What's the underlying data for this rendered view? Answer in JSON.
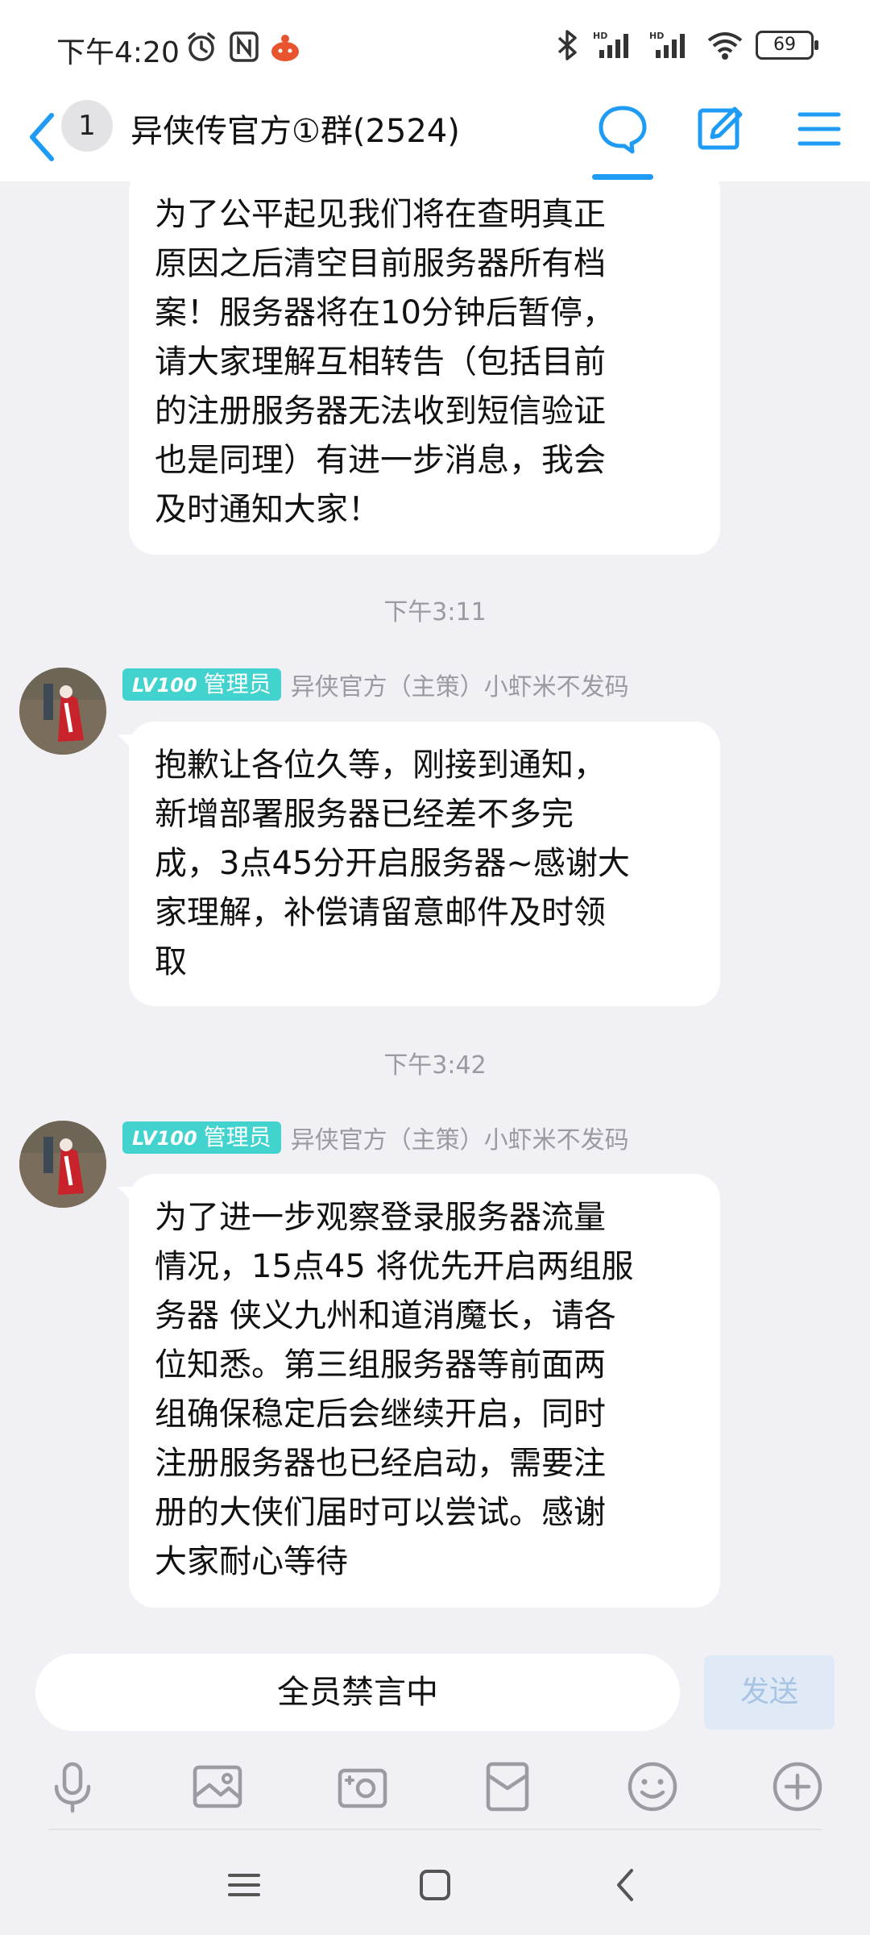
{
  "status_bar": {
    "time": "下午4:20",
    "battery": "69"
  },
  "header": {
    "unread_count": "1",
    "title": "异侠传官方①群(2524)"
  },
  "messages": [
    {
      "lines": [
        "为了公平起见我们将在查明真正",
        "原因之后清空目前服务器所有档",
        "案！服务器将在10分钟后暂停，",
        "请大家理解互相转告（包括目前",
        "的注册服务器无法收到短信验证",
        "也是同理）有进一步消息，我会",
        "及时通知大家！"
      ]
    },
    {
      "timestamp": "下午3:11",
      "level": "LV100",
      "role": "管理员",
      "sender": "异侠官方（主策）小虾米不发码",
      "lines": [
        "抱歉让各位久等，刚接到通知，",
        "新增部署服务器已经差不多完",
        "成，3点45分开启服务器~感谢大",
        "家理解，补偿请留意邮件及时领",
        "取"
      ]
    },
    {
      "timestamp": "下午3:42",
      "level": "LV100",
      "role": "管理员",
      "sender": "异侠官方（主策）小虾米不发码",
      "lines": [
        "为了进一步观察登录服务器流量",
        "情况，15点45 将优先开启两组服",
        "务器 侠义九州和道消魔长，请各",
        "位知悉。第三组服务器等前面两",
        "组确保稳定后会继续开启，同时",
        "注册服务器也已经启动，需要注",
        "册的大侠们届时可以尝试。感谢",
        "大家耐心等待"
      ]
    }
  ],
  "input": {
    "muted_text": "全员禁言中",
    "send_label": "发送"
  },
  "colors": {
    "accent": "#1e9bf5",
    "badge": "#43d3cf",
    "background": "#f1f1f5"
  }
}
